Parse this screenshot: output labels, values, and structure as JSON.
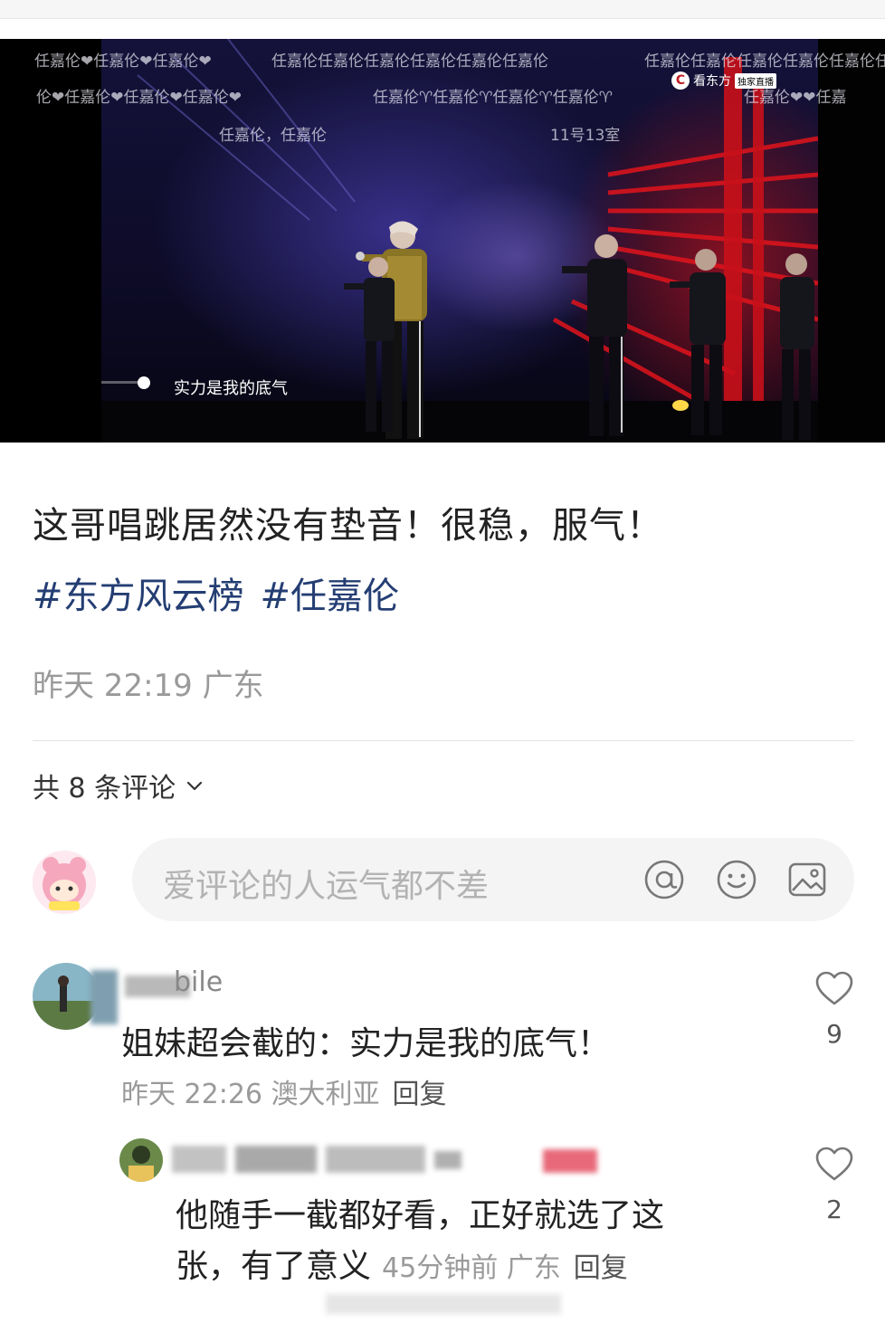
{
  "video": {
    "danmaku": [
      "任嘉伦❤任嘉伦❤任嘉伦❤",
      "任嘉伦任嘉伦任嘉伦任嘉伦任嘉伦任嘉伦",
      "任嘉伦任嘉伦任嘉伦任嘉伦任嘉伦任",
      "伦❤任嘉伦❤任嘉伦❤任嘉伦❤",
      "任嘉伦♈任嘉伦♈任嘉伦♈任嘉伦♈",
      "任嘉伦❤❤任嘉",
      "任嘉伦，任嘉伦",
      "11号13室"
    ],
    "brand": "看东方",
    "brand_tag": "独家直播",
    "subtitle": "实力是我的底气"
  },
  "post": {
    "title": "这哥唱跳居然没有垫音！很稳，服气！",
    "tags": [
      "#东方风云榜",
      "#任嘉伦"
    ],
    "time_location": "昨天 22:19 广东"
  },
  "comments_header": {
    "count_label": "共 8 条评论"
  },
  "comment_input": {
    "placeholder": "爱评论的人运气都不差",
    "icons": [
      "at-icon",
      "emoji-icon",
      "image-icon"
    ]
  },
  "comments": [
    {
      "username": "bile",
      "text": "姐妹超会截的：实力是我的底气！",
      "time": "昨天 22:26 澳大利亚",
      "reply_label": "回复",
      "likes": "9"
    },
    {
      "text_line1": "他随手一截都好看，正好就选了这",
      "text_line2": "张，有了意义",
      "time": "45分钟前 广东",
      "reply_label": "回复",
      "likes": "2"
    }
  ],
  "colors": {
    "tag_blue": "#243e73",
    "meta_gray": "#9a9a9a",
    "input_bg": "#f4f4f4"
  }
}
